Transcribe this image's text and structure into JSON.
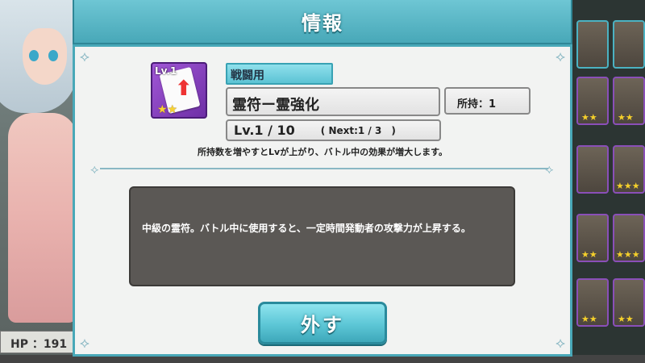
{
  "dialog": {
    "title": "情報",
    "item": {
      "icon_level": "Lv.1",
      "icon_stars": "★★",
      "category": "戦闘用",
      "name": "霊符ー霊強化",
      "owned": "所持：1",
      "level": "Lv.1 / 10",
      "next": "( Next:1 / 3　)",
      "info": "所持数を増やすとLvが上がり、バトル中の効果が増大します。",
      "description": "中級の霊符。バトル中に使用すると、一定時間発動者の攻撃力が上昇する。"
    },
    "remove_button": "外す"
  },
  "background": {
    "hp_text": "HP ：191"
  },
  "colors": {
    "accent": "#48a8b8",
    "panel": "#f2f3f2",
    "desc_bg": "#5b5855",
    "star": "#f5d02b"
  }
}
